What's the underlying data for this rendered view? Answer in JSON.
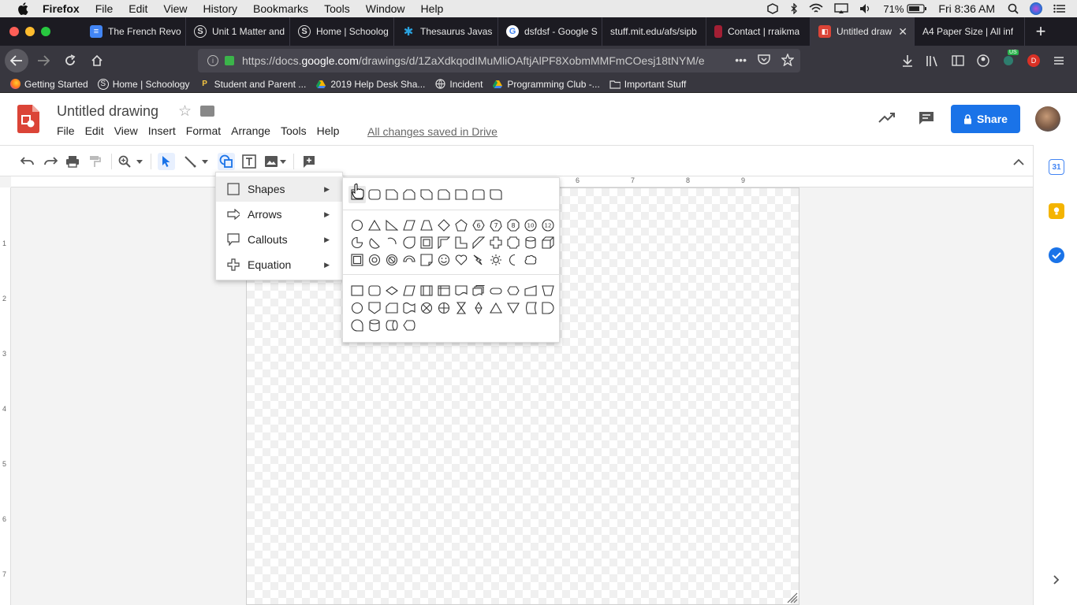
{
  "macbar": {
    "app": "Firefox",
    "menus": [
      "File",
      "Edit",
      "View",
      "History",
      "Bookmarks",
      "Tools",
      "Window",
      "Help"
    ],
    "battery": "71%",
    "clock": "Fri 8:36 AM"
  },
  "tabs": [
    {
      "title": "The French Revo",
      "icon_color": "#4285f4",
      "icon": "docs-icon"
    },
    {
      "title": "Unit 1 Matter and",
      "icon_color": "#555555",
      "icon": "schoology-icon"
    },
    {
      "title": "Home | Schoolog",
      "icon_color": "#555555",
      "icon": "schoology-icon"
    },
    {
      "title": "Thesaurus Javas",
      "icon_color": "#1f8ec4",
      "icon": "gear-icon"
    },
    {
      "title": "dsfdsf - Google S",
      "icon_color": "#ffffff",
      "icon": "google-icon"
    },
    {
      "title": "stuff.mit.edu/afs/sipb",
      "icon_color": "",
      "icon": ""
    },
    {
      "title": "Contact | rraikma",
      "icon_color": "#a31f34",
      "icon": "mit-icon"
    },
    {
      "title": "Untitled draw",
      "icon_color": "#db4437",
      "icon": "drawings-icon",
      "active": true
    },
    {
      "title": "A4 Paper Size | All inf",
      "icon_color": "",
      "icon": ""
    }
  ],
  "nav": {
    "url_prefix": "https://docs.",
    "url_domain": "google.com",
    "url_rest": "/drawings/d/1ZaXdkqodIMuMliOAftjAlPF8XobmMMFmCOesj18tNYM/e",
    "url_more": "•••"
  },
  "bookmarks": [
    {
      "label": "Getting Started",
      "icon": "firefox-icon"
    },
    {
      "label": "Home | Schoology",
      "icon": "schoology-icon"
    },
    {
      "label": "Student and Parent ...",
      "icon": "pearson-icon"
    },
    {
      "label": "2019 Help Desk Sha...",
      "icon": "drive-icon"
    },
    {
      "label": "Incident",
      "icon": "globe-icon"
    },
    {
      "label": "Programming Club -...",
      "icon": "drive-icon"
    },
    {
      "label": "Important Stuff",
      "icon": "folder-icon"
    }
  ],
  "docs": {
    "title": "Untitled drawing",
    "menus": [
      "File",
      "Edit",
      "View",
      "Insert",
      "Format",
      "Arrange",
      "Tools",
      "Help"
    ],
    "saved_status": "All changes saved in Drive",
    "share_label": "Share",
    "brand_color": "#db4437",
    "share_color": "#1a73e8"
  },
  "rulers": {
    "h_ticks": [
      "6",
      "7",
      "8",
      "9"
    ],
    "v_ticks": [
      "1",
      "2",
      "3",
      "4",
      "5",
      "6",
      "7"
    ]
  },
  "insert_menu": [
    {
      "label": "Shapes",
      "icon": "square-outline-icon",
      "highlighted": true
    },
    {
      "label": "Arrows",
      "icon": "arrow-right-icon"
    },
    {
      "label": "Callouts",
      "icon": "callout-icon"
    },
    {
      "label": "Equation",
      "icon": "plus-icon"
    }
  ],
  "shapes_palette": {
    "numbered_shapes": [
      "6",
      "7",
      "8",
      "10",
      "12"
    ]
  }
}
